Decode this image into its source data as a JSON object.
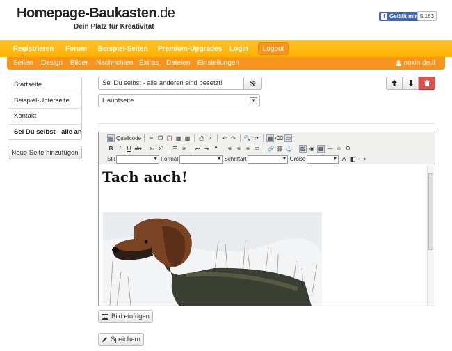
{
  "header": {
    "logo_main": "Homepage-Baukasten",
    "logo_tld": ".de",
    "tagline": "Dein Platz für Kreativität",
    "fb_like": "Gefällt mir",
    "fb_count": "5.163"
  },
  "mainnav": {
    "items": [
      "Registrieren",
      "Forum",
      "Beispiel-Seiten",
      "Premium-Upgrades",
      "Login"
    ],
    "logout": "Logout"
  },
  "subnav": {
    "items": [
      "Seiten",
      "Design",
      "Bilder",
      "Nachrichten",
      "Extras",
      "Dateien",
      "Einstellungen"
    ],
    "user": "noxin.de.tl"
  },
  "sidebar": {
    "pages": [
      "Startseite",
      "Beispiel-Unterseite",
      "Kontakt",
      "Sei Du selbst - alle anderen sind besetzt!"
    ],
    "add_button": "Neue Seite hinzufügen"
  },
  "form": {
    "title_value": "Sei Du selbst - alle anderen sind besetzt!",
    "parent_select": "Hauptseite"
  },
  "editor": {
    "source_label": "Quellcode",
    "style_label": "Stil",
    "format_label": "Format",
    "font_label": "Schriftart",
    "size_label": "Größe",
    "heading": "Tach auch!"
  },
  "actions": {
    "insert_image": "Bild einfügen",
    "save": "Speichern"
  },
  "colors": {
    "brand_orange": "#f7941d",
    "brand_yellow": "#ffb000",
    "danger": "#d9534f",
    "facebook": "#4267b2"
  }
}
